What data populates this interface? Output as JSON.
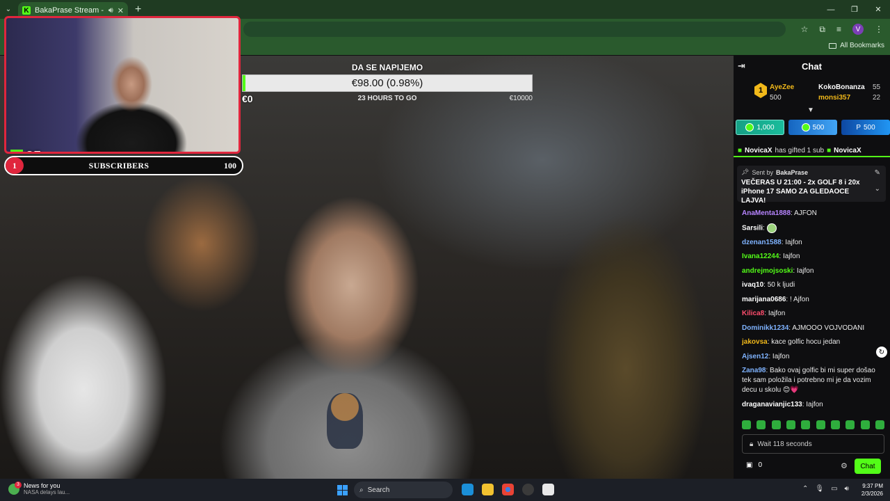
{
  "browser": {
    "tab_title": "BakaPrase Stream - Watch",
    "bookmarks_label": "All Bookmarks",
    "profile_initial": "V"
  },
  "overlay": {
    "webcam_count": "25",
    "subs_current": "1",
    "subs_label": "SUBSCRIBERS",
    "subs_goal": "100"
  },
  "goal": {
    "title": "DA SE NAPIJEMO",
    "value": "€98.00 (0.98%)",
    "progress_fraction": 0.0098,
    "min": "€0",
    "time_left": "23 HOURS TO GO",
    "max": "€10000"
  },
  "chat": {
    "title": "Chat",
    "leaderboard": {
      "first_name": "AyeZee",
      "first_value": "500",
      "rank": "1",
      "second_name": "KokoBonanza",
      "second_value": "55",
      "third_name": "monsi357",
      "third_value": "22"
    },
    "gift_buttons": [
      "1,000",
      "500",
      "500"
    ],
    "gifted_banner": {
      "user": "NovicaX",
      "text": "has gifted 1 sub",
      "trail": "NovicaX"
    },
    "pinned": {
      "sent_by": "Sent by",
      "author": "BakaPrase",
      "message": "VEČERAS U 21:00 - 2x GOLF 8 i 20x iPhone 17 SAMO ZA GLEDAOCE LAJVA!"
    },
    "messages": [
      {
        "user": "AnaMenta1888",
        "text": "AJFON",
        "color": "#b784ff"
      },
      {
        "user": "Sarsili",
        "text": "",
        "color": "#ffffff",
        "emote": true
      },
      {
        "user": "dzenan1588",
        "text": "Iajfon",
        "color": "#7fb3ff"
      },
      {
        "user": "Ivana12244",
        "text": "Iajfon",
        "color": "#53fc18"
      },
      {
        "user": "andrejmojsoski",
        "text": "Iajfon",
        "color": "#53fc18"
      },
      {
        "user": "ivaq10",
        "text": "50 k ljudi",
        "color": "#ffffff"
      },
      {
        "user": "marijana0686",
        "text": "! Ajfon",
        "color": "#ffffff"
      },
      {
        "user": "Kilica8",
        "text": "Iajfon",
        "color": "#ff4d6d"
      },
      {
        "user": "Dominikk1234",
        "text": "AJMOOO VOJVODANI",
        "color": "#7fb3ff"
      },
      {
        "user": "jakovsa",
        "text": "kace golfic hocu jedan",
        "color": "#f2b91a"
      },
      {
        "user": "Ajsen12",
        "text": "Iajfon",
        "color": "#7fb3ff"
      },
      {
        "user": "Zana98",
        "text": "Bako ovaj golfic bi mi super došao tek sam položila i potrebno mi je da vozim decu u skolu 😊💗",
        "color": "#7fb3ff"
      },
      {
        "user": "draganavianjic133",
        "text": "Iajfon",
        "color": "#ffffff"
      }
    ],
    "wait_text": "Wait 118 seconds",
    "kicks_count": "0",
    "chat_button": "Chat"
  },
  "taskbar": {
    "news_title": "News for you",
    "news_sub": "NASA delays lau...",
    "news_badge": "3",
    "search_label": "Search",
    "time": "9:37 PM",
    "date": "2/3/2026"
  }
}
